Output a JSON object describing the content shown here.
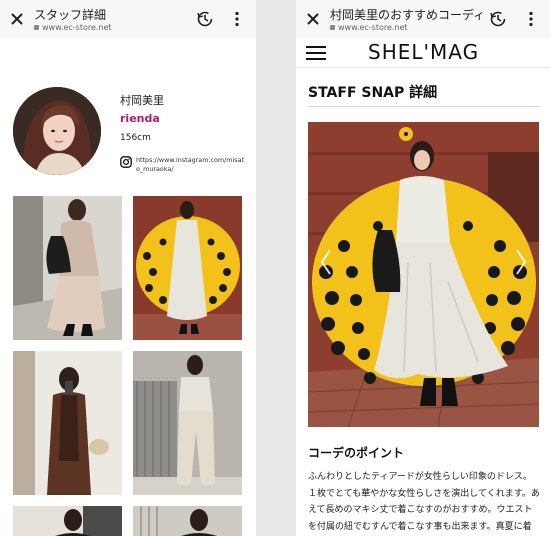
{
  "left": {
    "browser": {
      "title": "スタッフ詳細",
      "url": "www.ec-store.net"
    },
    "profile": {
      "name": "村岡美里",
      "brand": "rienda",
      "height": "156cm",
      "instagram": "https://www.instagram.com/misato_muraoka/"
    },
    "photos": [
      "beige-dress-snap",
      "pumpkin-snap",
      "brown-vest-snap",
      "white-overall-snap",
      "black-top-snap",
      "black-top-snap-2"
    ]
  },
  "right": {
    "browser": {
      "title": "村岡美里のおすすめコーディネ",
      "url": "www.ec-store.net"
    },
    "logo": "SHEL'MAG",
    "heading": "STAFF SNAP 詳細",
    "section_title": "コーデのポイント",
    "body_text": "ふんわりとしたティアードが女性らしい印象のドレス。１枚でとても華やかな女性らしさを演出してくれます。あえて長めのマキシ丈で着こなすのがおすすめ。ウエストを付属の紐でむすんで着こなす事も出来ます。真夏に着てビーサンなどで着こなすの"
  },
  "icons": {
    "close": "close-icon",
    "history": "history-icon",
    "menu": "more-vert-icon",
    "hamburger": "hamburger-icon",
    "instagram": "instagram-icon"
  },
  "colors": {
    "brand": "#b01964",
    "toolbar": "#f7f7f8"
  }
}
